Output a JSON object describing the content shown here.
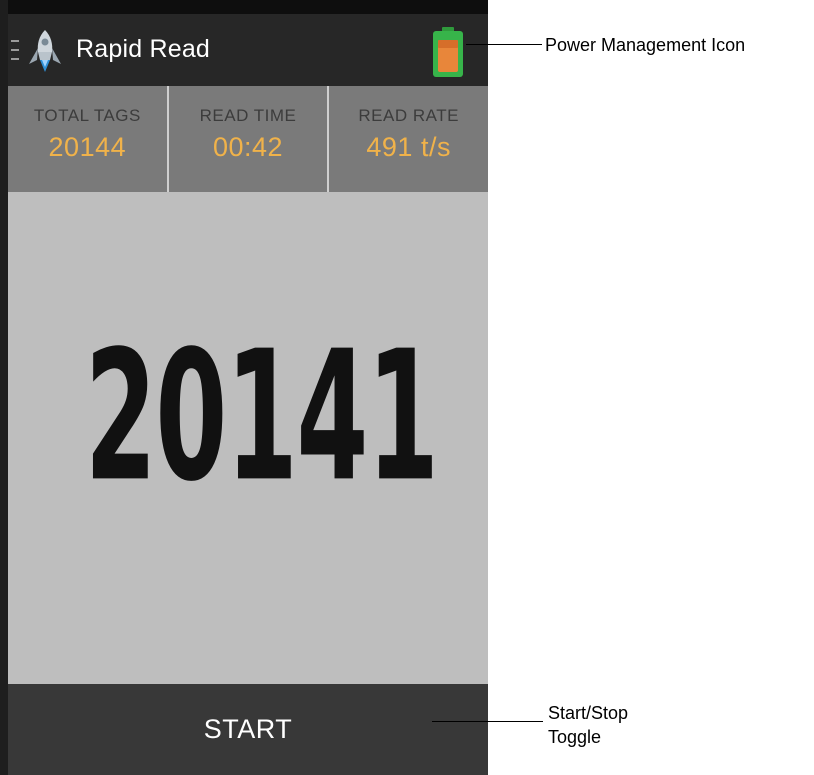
{
  "app": {
    "title": "Rapid Read"
  },
  "stats": [
    {
      "label": "TOTAL TAGS",
      "value": "20144"
    },
    {
      "label": "READ TIME",
      "value": "00:42"
    },
    {
      "label": "READ RATE",
      "value": "491 t/s"
    }
  ],
  "counter": {
    "value": "20141"
  },
  "controls": {
    "start_label": "START"
  },
  "annotations": {
    "power_management": "Power Management Icon",
    "start_stop_line1": "Start/Stop",
    "start_stop_line2": "Toggle"
  },
  "colors": {
    "action_bar": "#272727",
    "stats_bg": "#7a7a7a",
    "stat_value": "#f0b24a",
    "counter_bg": "#bebebe",
    "button_bg": "#383838",
    "battery_green": "#37b44a",
    "battery_orange": "#e8863a"
  },
  "icons": {
    "menu": "menu-icon",
    "logo": "rocket-icon",
    "power": "battery-icon"
  }
}
